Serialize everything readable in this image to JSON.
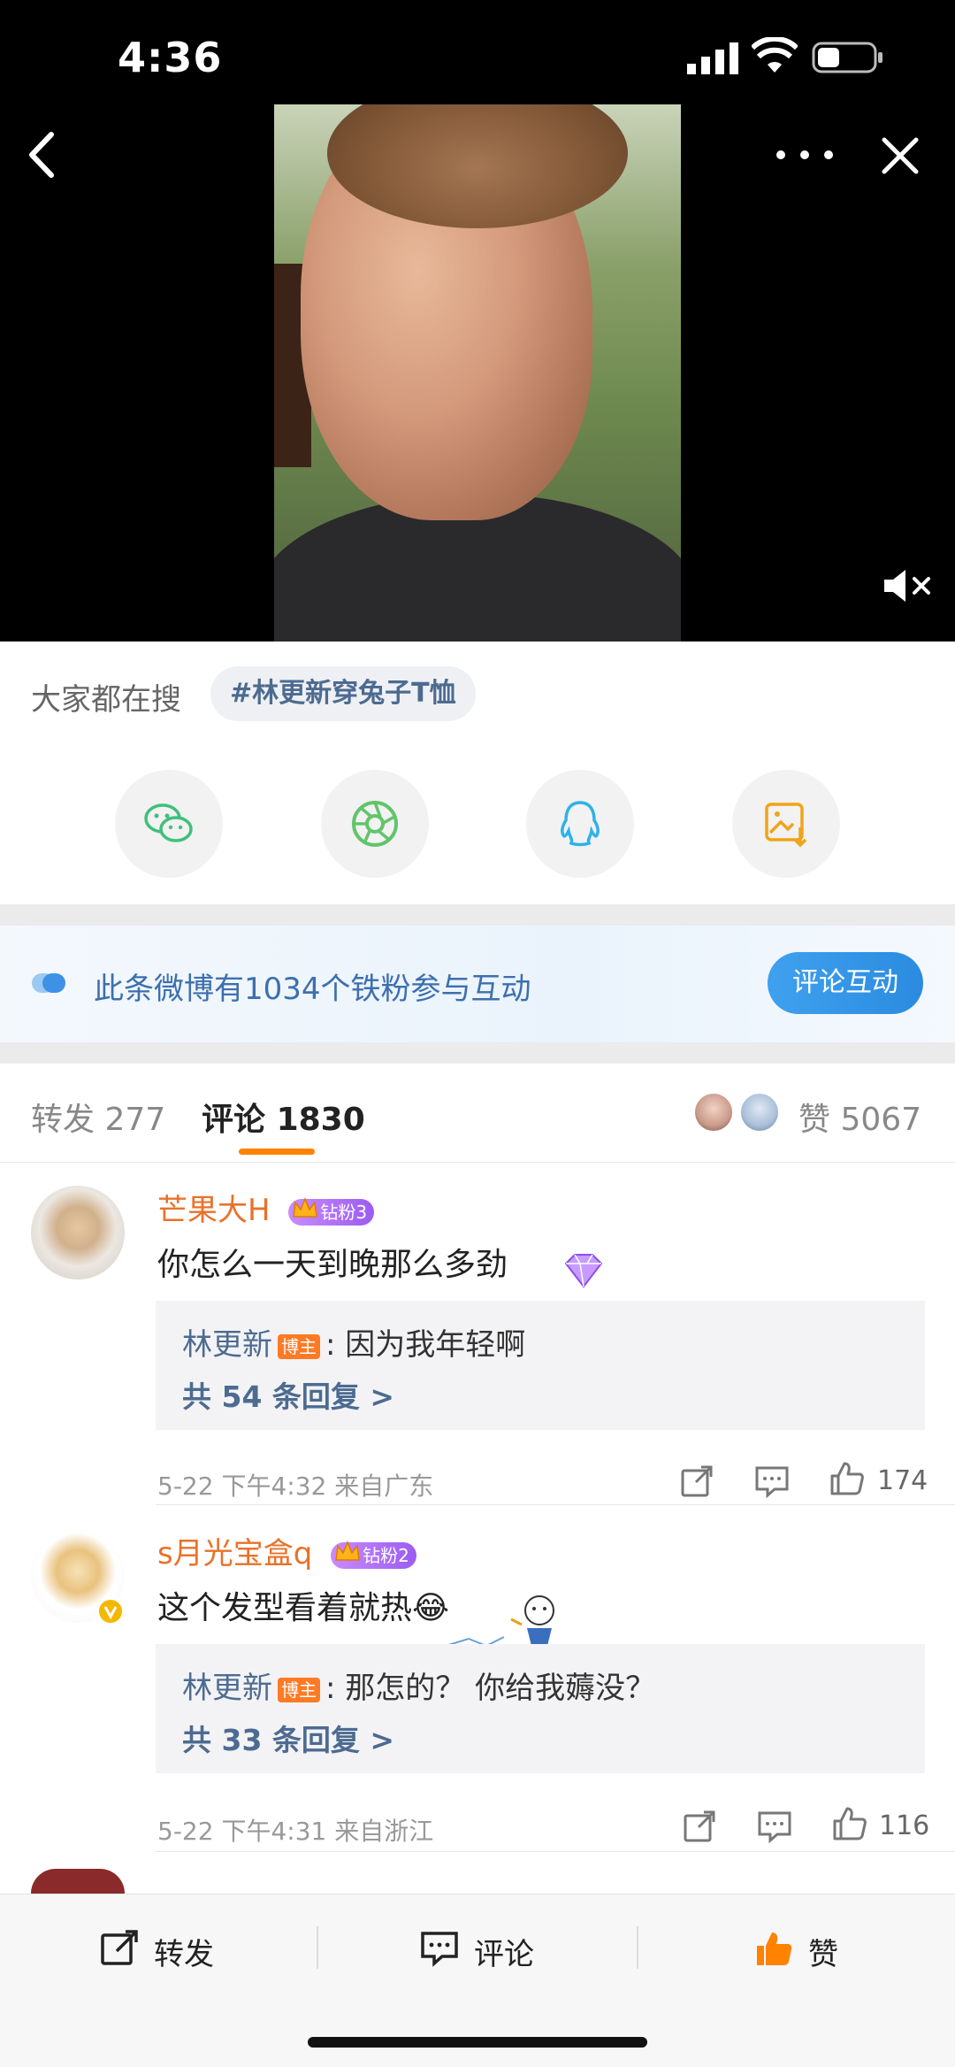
{
  "status": {
    "time": "4:36"
  },
  "search": {
    "label": "大家都在搜",
    "tag": "#林更新穿兔子T恤"
  },
  "share": {
    "icons": [
      "wechat-icon",
      "moments-icon",
      "qq-icon",
      "save-image-icon"
    ]
  },
  "banner": {
    "text": "此条微博有1034个铁粉参与互动",
    "button": "评论互动"
  },
  "tabs": {
    "repost_label": "转发",
    "repost_count": "277",
    "comment_label": "评论",
    "comment_count": "1830",
    "like_label": "赞",
    "like_count": "5067"
  },
  "comments": [
    {
      "name": "芒果大H",
      "badge": "钻粉3",
      "text": "你怎么一天到晚那么多劲",
      "reply_author": "林更新",
      "host_tag": "博主",
      "reply_text": ": 因为我年轻啊",
      "reply_count": "共 54 条回复 >",
      "meta": "5-22  下午4:32  来自广东",
      "likes": "174"
    },
    {
      "name": "s月光宝盒q",
      "badge": "钻粉2",
      "text": "这个发型看着就热😂",
      "reply_author": "林更新",
      "host_tag": "博主",
      "reply_text": ": 那怎的？ 你给我薅没？",
      "reply_count": "共 33 条回复 >",
      "meta": "5-22  下午4:31  来自浙江",
      "likes": "116"
    }
  ],
  "bottom": {
    "repost": "转发",
    "comment": "评论",
    "like": "赞"
  },
  "colors": {
    "accent": "#ff8200",
    "link": "#4d6b91",
    "username": "#e8722a",
    "button_blue": "#2b8be0"
  }
}
